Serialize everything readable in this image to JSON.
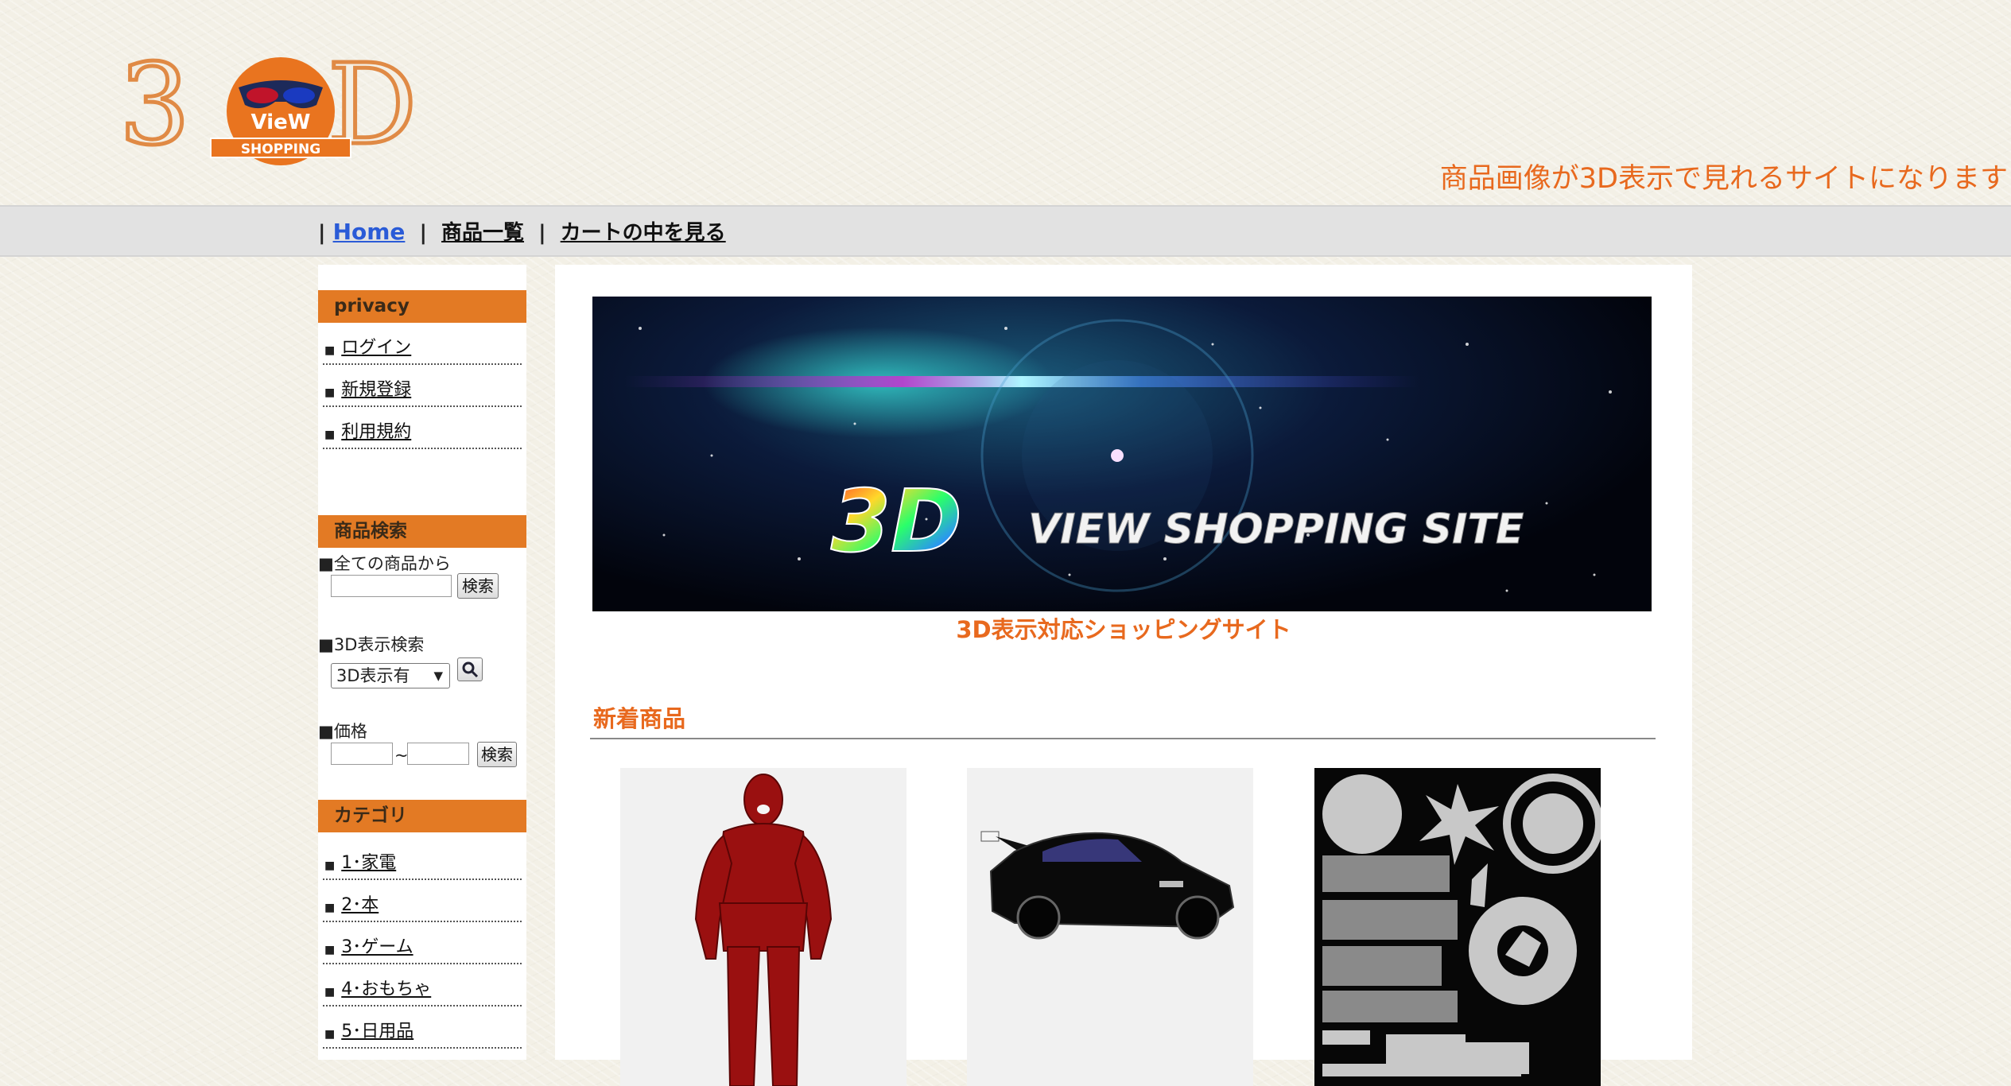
{
  "site": {
    "logo_text": "3D",
    "logo_badge": "VieW",
    "logo_sub": "SHOPPING",
    "tagline": "商品画像が3D表示で見れるサイトになります"
  },
  "nav": {
    "sep": "|",
    "home": "Home",
    "products": "商品一覧",
    "cart": "カートの中を見る"
  },
  "sidebar": {
    "privacy": {
      "title": "privacy",
      "items": [
        {
          "label": "ログイン"
        },
        {
          "label": "新規登録"
        },
        {
          "label": "利用規約"
        }
      ]
    },
    "search": {
      "title": "商品検索",
      "all_label": "■全ての商品から",
      "all_value": "",
      "search_btn": "検索",
      "view3d_label": "■3D表示検索",
      "view3d_selected": "3D表示有",
      "price_label": "■価格",
      "price_min": "",
      "price_tilde": "~",
      "price_max": "",
      "price_btn": "検索"
    },
    "category": {
      "title": "カテゴリ",
      "items": [
        {
          "label": "1･家電"
        },
        {
          "label": "2･本"
        },
        {
          "label": "3･ゲーム"
        },
        {
          "label": "4･おもちゃ"
        },
        {
          "label": "5･日用品"
        }
      ]
    }
  },
  "banner": {
    "logo": "3D",
    "text": "VIEW SHOPPING SITE",
    "caption": "3D表示対応ショッピングサイト"
  },
  "new_products": {
    "title": "新着商品",
    "items": [
      {
        "image": "red-muscular-figure-3d-model"
      },
      {
        "image": "black-race-car-3d-model"
      },
      {
        "image": "texture-map-3d-model"
      }
    ]
  },
  "colors": {
    "accent": "#e8691e",
    "sidebar_head": "#e37a24",
    "link_home": "#2a5bd7"
  }
}
